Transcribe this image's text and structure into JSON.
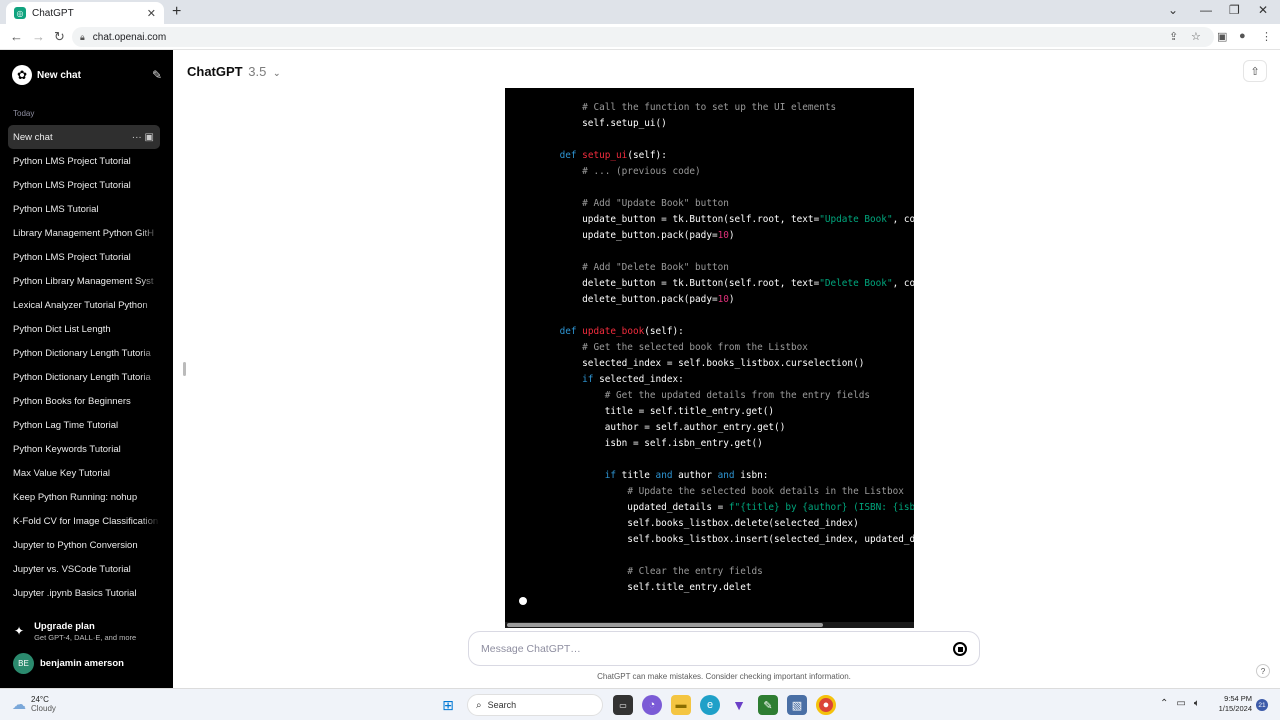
{
  "browser": {
    "tab_title": "ChatGPT",
    "url": "chat.openai.com",
    "new_tab_icon": "plus-icon"
  },
  "sidebar": {
    "new_chat_label": "New chat",
    "section_label": "Today",
    "chats": [
      {
        "label": "New chat",
        "active": true
      },
      {
        "label": "Python LMS Project Tutorial"
      },
      {
        "label": "Python LMS Project Tutorial"
      },
      {
        "label": "Python LMS Tutorial"
      },
      {
        "label": "Library Management Python GitH"
      },
      {
        "label": "Python LMS Project Tutorial"
      },
      {
        "label": "Python Library Management Syst"
      },
      {
        "label": "Lexical Analyzer Tutorial Python"
      },
      {
        "label": "Python Dict List Length"
      },
      {
        "label": "Python Dictionary Length Tutoria"
      },
      {
        "label": "Python Dictionary Length Tutoria"
      },
      {
        "label": "Python Books for Beginners"
      },
      {
        "label": "Python Lag Time Tutorial"
      },
      {
        "label": "Python Keywords Tutorial"
      },
      {
        "label": "Max Value Key Tutorial"
      },
      {
        "label": "Keep Python Running: nohup"
      },
      {
        "label": "K-Fold CV for Image Classification"
      },
      {
        "label": "Jupyter to Python Conversion"
      },
      {
        "label": "Jupyter vs. VSCode Tutorial"
      },
      {
        "label": "Jupyter .ipynb Basics Tutorial"
      }
    ],
    "upgrade_title": "Upgrade plan",
    "upgrade_subtitle": "Get GPT-4, DALL·E, and more",
    "user_initials": "BE",
    "user_name": "benjamin amerson"
  },
  "main": {
    "model_name": "ChatGPT",
    "model_version": "3.5",
    "composer_placeholder": "Message ChatGPT…",
    "disclaimer": "ChatGPT can make mistakes. Consider checking important information.",
    "help_label": "?"
  },
  "code_lines": [
    [
      {
        "t": "        "
      },
      {
        "t": "# Call the function to set up the UI elements",
        "c": "cmt"
      }
    ],
    [
      {
        "t": "        self.setup_ui()"
      }
    ],
    [
      {
        "t": ""
      }
    ],
    [
      {
        "t": "    "
      },
      {
        "t": "def",
        "c": "kw"
      },
      {
        "t": " "
      },
      {
        "t": "setup_ui",
        "c": "fn"
      },
      {
        "t": "(self):"
      }
    ],
    [
      {
        "t": "        "
      },
      {
        "t": "# ... (previous code)",
        "c": "cmt"
      }
    ],
    [
      {
        "t": ""
      }
    ],
    [
      {
        "t": "        "
      },
      {
        "t": "# Add \"Update Book\" button",
        "c": "cmt"
      }
    ],
    [
      {
        "t": "        update_button = tk.Button(self.root, text="
      },
      {
        "t": "\"Update Book\"",
        "c": "str"
      },
      {
        "t": ", comman"
      }
    ],
    [
      {
        "t": "        update_button.pack(pady="
      },
      {
        "t": "10",
        "c": "num"
      },
      {
        "t": ")"
      }
    ],
    [
      {
        "t": ""
      }
    ],
    [
      {
        "t": "        "
      },
      {
        "t": "# Add \"Delete Book\" button",
        "c": "cmt"
      }
    ],
    [
      {
        "t": "        delete_button = tk.Button(self.root, text="
      },
      {
        "t": "\"Delete Book\"",
        "c": "str"
      },
      {
        "t": ", comman"
      }
    ],
    [
      {
        "t": "        delete_button.pack(pady="
      },
      {
        "t": "10",
        "c": "num"
      },
      {
        "t": ")"
      }
    ],
    [
      {
        "t": ""
      }
    ],
    [
      {
        "t": "    "
      },
      {
        "t": "def",
        "c": "kw"
      },
      {
        "t": " "
      },
      {
        "t": "update_book",
        "c": "fn"
      },
      {
        "t": "(self):"
      }
    ],
    [
      {
        "t": "        "
      },
      {
        "t": "# Get the selected book from the Listbox",
        "c": "cmt"
      }
    ],
    [
      {
        "t": "        selected_index = self.books_listbox.curselection()"
      }
    ],
    [
      {
        "t": "        "
      },
      {
        "t": "if",
        "c": "kw"
      },
      {
        "t": " selected_index:"
      }
    ],
    [
      {
        "t": "            "
      },
      {
        "t": "# Get the updated details from the entry fields",
        "c": "cmt"
      }
    ],
    [
      {
        "t": "            title = self.title_entry.get()"
      }
    ],
    [
      {
        "t": "            author = self.author_entry.get()"
      }
    ],
    [
      {
        "t": "            isbn = self.isbn_entry.get()"
      }
    ],
    [
      {
        "t": ""
      }
    ],
    [
      {
        "t": "            "
      },
      {
        "t": "if",
        "c": "kw"
      },
      {
        "t": " title "
      },
      {
        "t": "and",
        "c": "kw"
      },
      {
        "t": " author "
      },
      {
        "t": "and",
        "c": "kw"
      },
      {
        "t": " isbn:"
      }
    ],
    [
      {
        "t": "                "
      },
      {
        "t": "# Update the selected book details in the Listbox",
        "c": "cmt"
      }
    ],
    [
      {
        "t": "                updated_details = "
      },
      {
        "t": "f\"{title} by {author} (ISBN: {isbn})\"",
        "c": "str"
      }
    ],
    [
      {
        "t": "                self.books_listbox.delete(selected_index)"
      }
    ],
    [
      {
        "t": "                self.books_listbox.insert(selected_index, updated_detai"
      }
    ],
    [
      {
        "t": ""
      }
    ],
    [
      {
        "t": "                "
      },
      {
        "t": "# Clear the entry fields",
        "c": "cmt"
      }
    ],
    [
      {
        "t": "                self.title_entry.delet"
      }
    ]
  ],
  "taskbar": {
    "temperature": "24°C",
    "condition": "Cloudy",
    "search_label": "Search",
    "time": "9:54 PM",
    "date": "1/15/2024",
    "notification_count": "21"
  }
}
